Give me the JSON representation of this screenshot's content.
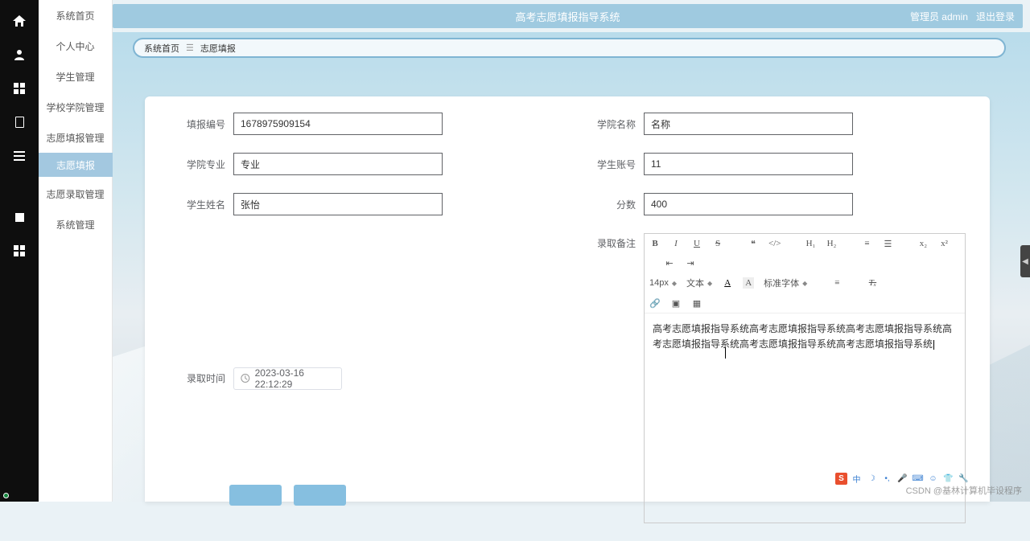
{
  "app": {
    "title": "高考志愿填报指导系统"
  },
  "header": {
    "role_user": "管理员 admin",
    "logout": "退出登录"
  },
  "sidebar": {
    "items": [
      {
        "label": "系统首页"
      },
      {
        "label": "个人中心"
      },
      {
        "label": "学生管理"
      },
      {
        "label": "学校学院管理"
      },
      {
        "label": "志愿填报管理"
      },
      {
        "label": "志愿录取管理"
      },
      {
        "label": "系统管理"
      }
    ],
    "sub_active": "志愿填报"
  },
  "breadcrumb": {
    "home": "系统首页",
    "current": "志愿填报"
  },
  "form": {
    "labels": {
      "fill_id": "填报编号",
      "college_name": "学院名称",
      "major": "学院专业",
      "student_acct": "学生账号",
      "student_name": "学生姓名",
      "score": "分数",
      "admit_time": "录取时间",
      "admit_note": "录取备注"
    },
    "values": {
      "fill_id": "1678975909154",
      "college_name": "名称",
      "major": "专业",
      "student_acct": "11",
      "student_name": "张怡",
      "score": "400",
      "admit_time": "2023-03-16 22:12:29"
    },
    "note_text": "高考志愿填报指导系统高考志愿填报指导系统高考志愿填报指导系统高考志愿填报指导系统高考志愿填报指导系统高考志愿填报指导系统"
  },
  "editor": {
    "font_size": "14px",
    "block_fmt": "文本",
    "font_family": "标准字体"
  },
  "watermark": "CSDN @基林计算机毕设程序"
}
